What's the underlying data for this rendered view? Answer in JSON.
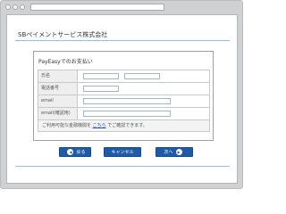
{
  "browser": {
    "address_value": ""
  },
  "page": {
    "merchant_title": "SBペイメントサービス株式会社",
    "form_title": "PayEasyでのお支払い",
    "fields": [
      {
        "label": "氏名"
      },
      {
        "label": "電話番号"
      },
      {
        "label": "email"
      },
      {
        "label": "email(確認用)"
      }
    ],
    "note_before": "ご利用可能な金融機関を",
    "note_link": "こちら",
    "note_after": "でご確認できます。",
    "buttons": {
      "back": "戻る",
      "back_icon": "◀",
      "cancel": "キャンセル",
      "next": "次へ",
      "next_icon": "▶"
    }
  },
  "colors": {
    "accent": "#1f5aa6",
    "rule": "#8fc6da",
    "link": "#1a4fb5"
  }
}
